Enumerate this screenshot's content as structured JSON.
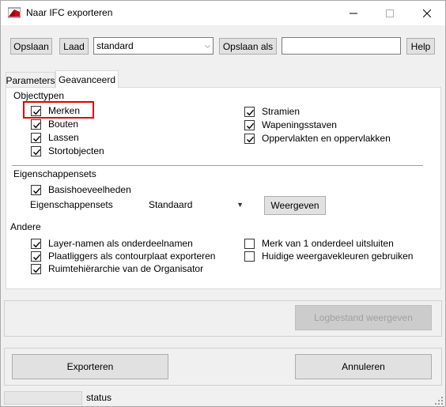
{
  "window": {
    "title": "Naar IFC exporteren",
    "controls": [
      "minimize",
      "maximize",
      "close"
    ]
  },
  "toolbar": {
    "save_label": "Opslaan",
    "load_label": "Laad",
    "preset_value": "standard",
    "save_as_label": "Opslaan als",
    "save_as_value": "",
    "help_label": "Help"
  },
  "tabs": [
    {
      "label": "Parameters",
      "active": false
    },
    {
      "label": "Geavanceerd",
      "active": true
    }
  ],
  "objecttypen": {
    "label": "Objecttypen",
    "left": [
      {
        "label": "Merken",
        "checked": true
      },
      {
        "label": "Bouten",
        "checked": true
      },
      {
        "label": "Lassen",
        "checked": true
      },
      {
        "label": "Stortobjecten",
        "checked": true
      }
    ],
    "right": [
      {
        "label": "Stramien",
        "checked": true
      },
      {
        "label": "Wapeningsstaven",
        "checked": true
      },
      {
        "label": "Oppervlakten en oppervlakken",
        "checked": true
      }
    ]
  },
  "eigenschappensets": {
    "label": "Eigenschappensets",
    "basis": {
      "label": "Basishoeveelheden",
      "checked": true
    },
    "sets_label": "Eigenschappensets",
    "sets_value": "Standaard",
    "show_label": "Weergeven"
  },
  "andere": {
    "label": "Andere",
    "left": [
      {
        "label": "Layer-namen als onderdeelnamen",
        "checked": true
      },
      {
        "label": "Plaatliggers als contourplaat exporteren",
        "checked": true
      },
      {
        "label": "Ruimtehiërarchie van de Organisator",
        "checked": true
      }
    ],
    "right": [
      {
        "label": "Merk van 1 onderdeel uitsluiten",
        "checked": false
      },
      {
        "label": "Huidige weergavekleuren gebruiken",
        "checked": false
      }
    ]
  },
  "log": {
    "label": "Logbestand weergeven",
    "enabled": false
  },
  "actions": {
    "export_label": "Exporteren",
    "cancel_label": "Annuleren"
  },
  "status": {
    "pane": "",
    "text": "status"
  },
  "colors": {
    "highlight": "#e00000",
    "window_bg": "#f0f0f0",
    "button_bg": "#e1e1e1"
  }
}
